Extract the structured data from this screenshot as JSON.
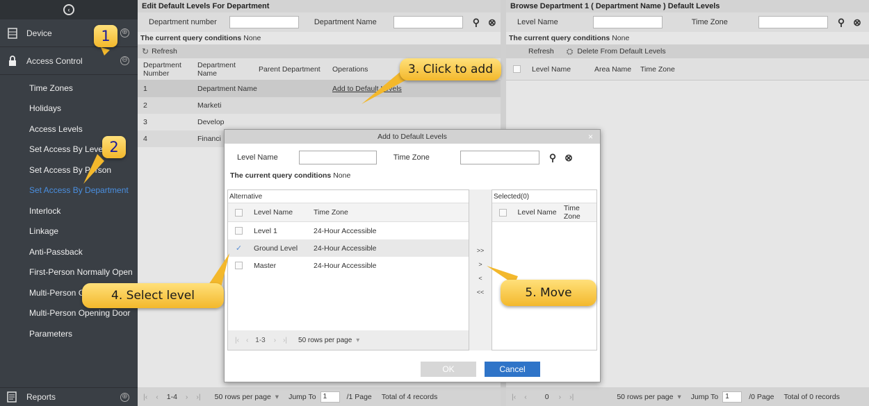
{
  "sidebar": {
    "groups": [
      {
        "label": "Device",
        "icon": "device-icon",
        "toggle": "⊕"
      },
      {
        "label": "Access Control",
        "icon": "lock-icon",
        "toggle": "⊖"
      }
    ],
    "items": [
      {
        "label": "Time Zones"
      },
      {
        "label": "Holidays"
      },
      {
        "label": "Access Levels"
      },
      {
        "label": "Set Access By Levels"
      },
      {
        "label": "Set Access By Person"
      },
      {
        "label": "Set Access By Department",
        "active": true
      },
      {
        "label": "Interlock"
      },
      {
        "label": "Linkage"
      },
      {
        "label": "Anti-Passback"
      },
      {
        "label": "First-Person Normally Open"
      },
      {
        "label": "Multi-Person Group"
      },
      {
        "label": "Multi-Person Opening Door"
      },
      {
        "label": "Parameters"
      }
    ],
    "bottom": {
      "label": "Reports",
      "icon": "reports-icon",
      "toggle": "⊕"
    }
  },
  "left_panel": {
    "title": "Edit Default Levels For Department",
    "dept_number_label": "Department number",
    "dept_name_label": "Department Name",
    "query_cond": "The current query conditions",
    "query_value": "None",
    "refresh": "Refresh",
    "columns": [
      "Department Number",
      "Department Name",
      "Parent Department",
      "Operations"
    ],
    "rows": [
      {
        "num": "1",
        "name": "Department Name",
        "parent": "",
        "op": "Add to Default Levels"
      },
      {
        "num": "2",
        "name": "Marketi",
        "parent": "",
        "op": ""
      },
      {
        "num": "3",
        "name": "Develop",
        "parent": "",
        "op": ""
      },
      {
        "num": "4",
        "name": "Financi",
        "parent": "",
        "op": ""
      }
    ],
    "footer": {
      "range": "1-4",
      "rows_per_page": "50 rows per page",
      "jump_to": "Jump To",
      "page": "1",
      "pages": "/1 Page",
      "total": "Total of 4 records"
    }
  },
  "right_panel": {
    "title": "Browse Department 1 ( Department Name ) Default Levels",
    "level_name_label": "Level Name",
    "time_zone_label": "Time Zone",
    "query_cond": "The current query conditions",
    "query_value": "None",
    "refresh": "Refresh",
    "delete": "Delete From Default Levels",
    "columns": [
      "Level Name",
      "Area Name",
      "Time Zone"
    ],
    "footer": {
      "range": "0",
      "rows_per_page": "50 rows per page",
      "jump_to": "Jump To",
      "page": "1",
      "pages": "/0 Page",
      "total": "Total of 0 records"
    }
  },
  "modal": {
    "title": "Add to Default Levels",
    "close": "×",
    "level_name_label": "Level Name",
    "time_zone_label": "Time Zone",
    "query_cond": "The current query conditions",
    "query_value": "None",
    "alternative_caption": "Alternative",
    "selected_caption": "Selected(0)",
    "columns": [
      "Level Name",
      "Time Zone"
    ],
    "rows": [
      {
        "name": "Level 1",
        "tz": "24-Hour Accessible",
        "checked": false
      },
      {
        "name": "Ground Level",
        "tz": "24-Hour Accessible",
        "checked": true
      },
      {
        "name": "Master",
        "tz": "24-Hour Accessible",
        "checked": false
      }
    ],
    "pager": {
      "range": "1-3",
      "rows_per_page": "50 rows per page"
    },
    "move_buttons": [
      ">>",
      ">",
      "<",
      "<<"
    ],
    "ok": "OK",
    "cancel": "Cancel"
  },
  "callouts": {
    "step1": "1",
    "step2": "2",
    "step3": "3. Click to add",
    "step4": "4. Select level",
    "step5": "5. Move"
  }
}
